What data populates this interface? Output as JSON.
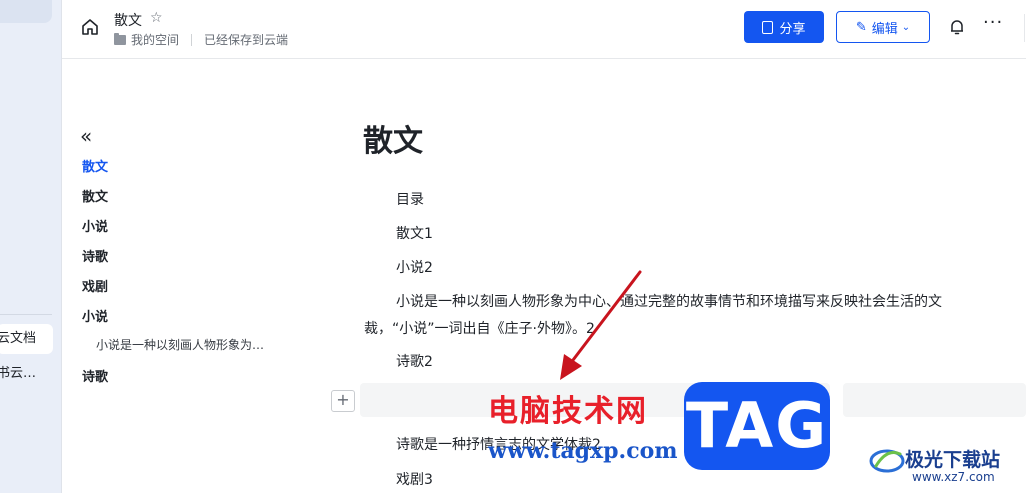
{
  "app_sidebar": {
    "items": [
      {
        "label": "云文档",
        "active": true
      },
      {
        "label": "书云…",
        "active": false
      }
    ]
  },
  "header": {
    "doc_title": "散文",
    "breadcrumb_space": "我的空间",
    "save_status": "已经保存到云端",
    "share_label": "分享",
    "edit_label": "编辑"
  },
  "outline": {
    "items": [
      {
        "label": "散文",
        "active": true
      },
      {
        "label": "散文"
      },
      {
        "label": "小说"
      },
      {
        "label": "诗歌"
      },
      {
        "label": "戏剧"
      },
      {
        "label": "小说"
      },
      {
        "label": "小说是一种以刻画人物形象为…",
        "sub": true
      },
      {
        "label": "诗歌"
      }
    ]
  },
  "document": {
    "title": "散文",
    "lines": [
      "目录",
      "散文1",
      "小说2",
      "小说是一种以刻画人物形象为中心、通过完整的故事情节和环境描写来反映社会生活的文",
      "裁，“小说”一词出自《庄子·外物》。2",
      "诗歌2",
      "诗歌是一种抒情言志的文学体裁2",
      "戏剧3"
    ]
  },
  "watermark": {
    "cn_text": "电脑技术网",
    "url": "www.tagxp.com",
    "tag": "TAG",
    "site_name": "极光下载站",
    "site_url": "www.xz7.com"
  },
  "colors": {
    "accent": "#1456f0",
    "watermark_red": "#e8202a",
    "annotation_arrow": "#c8141e"
  }
}
